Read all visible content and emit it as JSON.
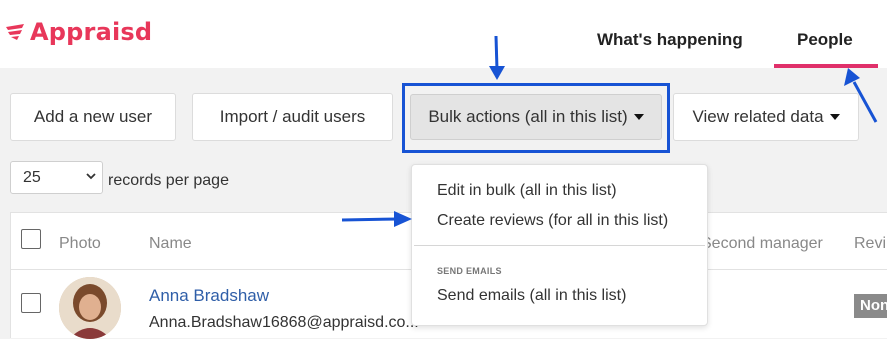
{
  "brand": {
    "name": "Appraisd",
    "color": "#e8375a",
    "icon": "winged-logo-icon"
  },
  "nav": {
    "tabs": [
      {
        "label": "What's happening",
        "active": false
      },
      {
        "label": "People",
        "active": true
      }
    ],
    "active_color": "#e0306a"
  },
  "toolbar": {
    "add_user": "Add a new user",
    "import_users": "Import / audit users",
    "bulk_actions": "Bulk actions (all in this list)",
    "view_related": "View related data"
  },
  "pagination": {
    "per_page_value": "25",
    "per_page_label": "records per page"
  },
  "table": {
    "columns": [
      "Photo",
      "Name",
      "Second manager",
      "Revi"
    ],
    "rows": [
      {
        "name": "Anna Bradshaw",
        "email": "Anna.Bradshaw16868@appraisd.co...",
        "review_badge": "Non"
      }
    ]
  },
  "bulk_menu": {
    "items": [
      "Edit in bulk (all in this list)",
      "Create reviews (for all in this list)"
    ],
    "send_emails_header": "SEND EMAILS",
    "send_emails_item": "Send emails (all in this list)"
  },
  "annotation_color": "#1753d4"
}
